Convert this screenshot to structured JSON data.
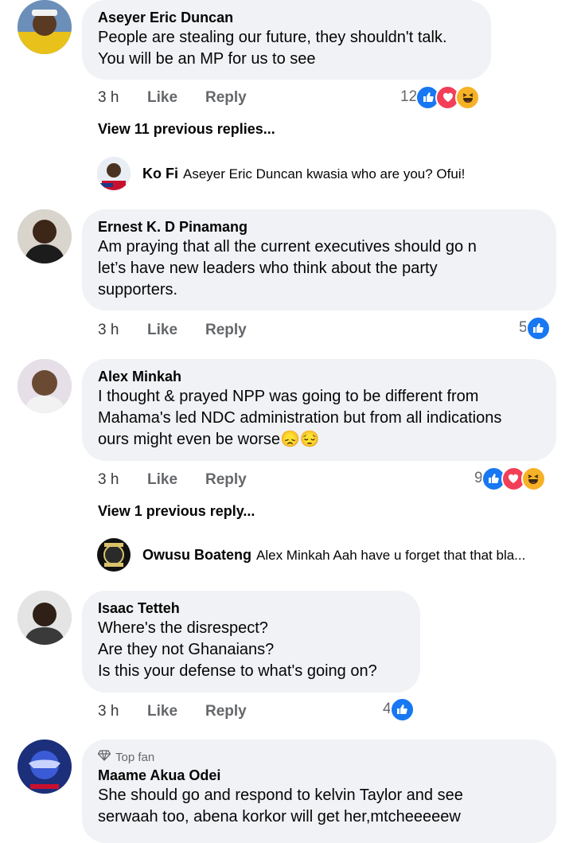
{
  "actions": {
    "like": "Like",
    "reply": "Reply"
  },
  "comments": [
    {
      "author": "Aseyer Eric Duncan",
      "lines": [
        "People are stealing our future, they shouldn't talk.",
        "You will be an MP for us to see"
      ],
      "time": "3 h",
      "reaction_count": "12",
      "reactions": [
        "like-icon",
        "love-icon",
        "haha-icon"
      ],
      "view_previous": "View 11 previous replies...",
      "reply": {
        "author": "Ko Fi",
        "text": "Aseyer Eric Duncan kwasia who are you? Ofui!"
      }
    },
    {
      "author": "Ernest K. D Pinamang",
      "lines": [
        "Am praying that all the current executives should go n",
        "let’s have new leaders who think about the party",
        "supporters."
      ],
      "time": "3 h",
      "reaction_count": "5",
      "reactions": [
        "like-icon"
      ]
    },
    {
      "author": "Alex Minkah",
      "lines": [
        "I thought & prayed NPP was going to be different from",
        "Mahama's led NDC administration but from all indications",
        "ours might even be worse😞😔"
      ],
      "time": "3 h",
      "reaction_count": "9",
      "reactions": [
        "like-icon",
        "love-icon",
        "haha-icon"
      ],
      "view_previous": "View 1 previous reply...",
      "reply": {
        "author": "Owusu Boateng",
        "text": "Alex Minkah Aah have u forget  that that bla..."
      }
    },
    {
      "author": "Isaac Tetteh",
      "lines": [
        "Where's the disrespect?",
        "Are they not Ghanaians?",
        "Is this your defense to what's going on?"
      ],
      "time": "3 h",
      "reaction_count": "4",
      "reactions": [
        "like-icon"
      ]
    },
    {
      "badge": "Top fan",
      "author": "Maame Akua Odei",
      "lines": [
        "She should go and respond to kelvin Taylor and see",
        "serwaah too, abena korkor will get her,mtcheeeeew"
      ]
    }
  ]
}
